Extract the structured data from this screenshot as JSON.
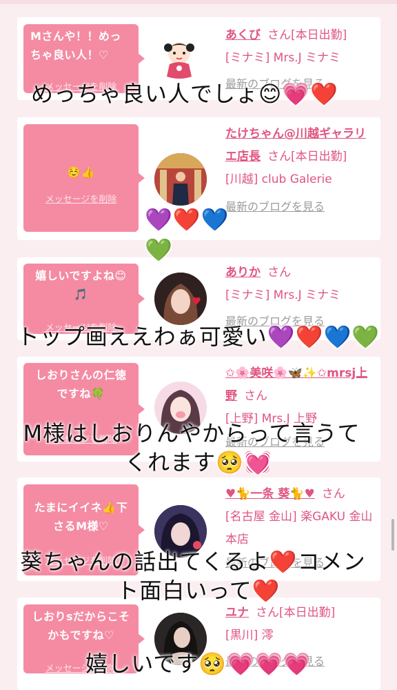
{
  "cards": [
    {
      "message": "Mさんや！！めっちゃ良い人！♡",
      "delete_label": "メッセージを削除",
      "name": "あくび",
      "honorific": "さん[本日出勤]",
      "shop": "[ミナミ] Mrs.J ミナミ",
      "blog_label": "最新のブログを見る"
    },
    {
      "message": "☺️👍",
      "delete_label": "メッセージを削除",
      "name": "たけちゃん@川越ギャラリエ店長",
      "honorific": "さん[本日出勤]",
      "shop": "[川越] club Galerie",
      "blog_label": "最新のブログを見る"
    },
    {
      "message": "嬉しいですよね😊🎵",
      "delete_label": "メッセージを削除",
      "name": "ありか",
      "honorific": "さん",
      "shop": "[ミナミ] Mrs.J ミナミ",
      "blog_label": "最新のブログを見る"
    },
    {
      "message": "しおりさんの仁徳ですね🍀",
      "delete_label": "メッセージを削除",
      "name": "✩🌸美咲🌸🦋✨✩mrsj上野",
      "honorific": "さん",
      "shop": "[上野] Mrs.J 上野",
      "blog_label": "最新のブログを見る"
    },
    {
      "message": "たまにイイネ👍下さるM様♡",
      "delete_label": "メッセージを削除",
      "name": "♥🐈一条 葵🐈♥",
      "honorific": "さん",
      "shop": "[名古屋 金山] 楽GAKU 金山本店",
      "blog_label": "最新のブログを見る"
    },
    {
      "message": "しおりsだからこそかもですね♡",
      "delete_label": "メッセージを削除",
      "name": "ユナ",
      "honorific": "さん[本日出勤]",
      "shop": "[黒川] 澪",
      "blog_label": "最新のブログを見る"
    }
  ],
  "captions": {
    "c1": "めっちゃ良い人でしょ😊💗❤️",
    "c2": "💜❤️💙💚",
    "c3": "トップ画ええわぁ可愛い💜❤️💙💚",
    "c4a": "M様はしおりんやからって言うて",
    "c4b": "くれます🥺💓",
    "c5a": "葵ちゃんの話出てくるよ❤️コメン",
    "c5b": "ト面白いって❤️",
    "c6": "嬉しいです🥺💗💗💗"
  },
  "colors": {
    "bubble": "#f48ba3",
    "name": "#e05580",
    "background": "#fbeef1"
  }
}
